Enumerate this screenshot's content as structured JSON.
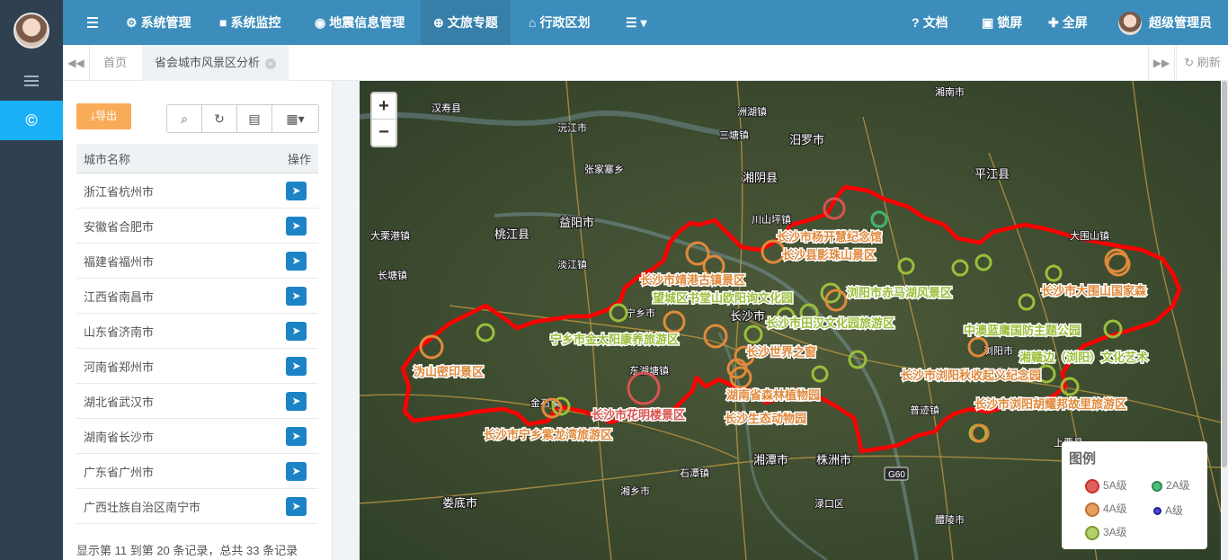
{
  "topbar": {
    "menu_items": [
      {
        "icon": "gear-icon",
        "label": "系统管理"
      },
      {
        "icon": "video-camera-icon",
        "label": "系统监控"
      },
      {
        "icon": "map-marker-icon",
        "label": "地震信息管理"
      },
      {
        "icon": "globe-icon",
        "label": "文旅专题"
      },
      {
        "icon": "bank-icon",
        "label": "行政区划"
      }
    ],
    "right_items": [
      {
        "icon": "question-circle-icon",
        "label": "文档"
      },
      {
        "icon": "lock-icon",
        "label": "锁屏"
      },
      {
        "icon": "expand-icon",
        "label": "全屏"
      }
    ],
    "username": "超级管理员"
  },
  "tabs": {
    "home": "首页",
    "active": "省会城市风景区分析",
    "refresh": "刷新"
  },
  "panel": {
    "export_label": "导出",
    "column_city": "城市名称",
    "column_action": "操作",
    "rows": [
      "浙江省杭州市",
      "安徽省合肥市",
      "福建省福州市",
      "江西省南昌市",
      "山东省济南市",
      "河南省郑州市",
      "湖北省武汉市",
      "湖南省长沙市",
      "广东省广州市",
      "广西壮族自治区南宁市"
    ],
    "footer": "显示第 11 到第 20 条记录，总共 33 条记录"
  },
  "map": {
    "zoom_in": "+",
    "zoom_out": "−",
    "places": [
      "汉寿县",
      "沅江市",
      "三塘镇",
      "汨罗市",
      "湘阴县",
      "平江县",
      "益阳市",
      "桃江县",
      "宁乡市",
      "长沙市",
      "浏阳市",
      "湘潭市",
      "株洲市",
      "娄底市",
      "湘乡市",
      "醴陵市",
      "张家塞乡",
      "大栗港镇",
      "长塘镇",
      "淡江镇",
      "川山坪镇",
      "洲湖镇",
      "大围山镇",
      "普迹镇",
      "上栗县",
      "东湖塘镇",
      "金石镇",
      "湘南市",
      "石潭镇",
      "渌口区"
    ],
    "spots": [
      {
        "label": "长沙市杨开慧纪念馆",
        "color": "#d9534f"
      },
      {
        "label": "长沙县影珠山景区",
        "color": "#e08a3c"
      },
      {
        "label": "长沙市靖港古镇景区",
        "color": "#e08a3c"
      },
      {
        "label": "望城区书堂山欧阳询文化园",
        "color": "#9bbf3b"
      },
      {
        "label": "浏阳市赤马湖风景区",
        "color": "#9bbf3b"
      },
      {
        "label": "长沙市大围山国家森",
        "color": "#e08a3c"
      },
      {
        "label": "长沙市田汉文化园旅游区",
        "color": "#9bbf3b"
      },
      {
        "label": "宁乡市金太阳康养旅游区",
        "color": "#9bbf3b"
      },
      {
        "label": "长沙世界之窗",
        "color": "#e08a3c"
      },
      {
        "label": "中澳蓝鹰国防主题公园",
        "color": "#9bbf3b"
      },
      {
        "label": "湘赣边（浏阳）文化艺术",
        "color": "#9bbf3b"
      },
      {
        "label": "沩山密印景区",
        "color": "#e08a3c"
      },
      {
        "label": "长沙市浏阳秋收起义纪念园",
        "color": "#e08a3c"
      },
      {
        "label": "湖南省森林植物园",
        "color": "#e08a3c"
      },
      {
        "label": "长沙市浏阳胡耀邦故里旅游区",
        "color": "#e08a3c"
      },
      {
        "label": "长沙市花明楼景区",
        "color": "#d9534f"
      },
      {
        "label": "长沙生态动物园",
        "color": "#e08a3c"
      },
      {
        "label": "长沙市宁乡紫龙湾旅游区",
        "color": "#e08a3c"
      }
    ],
    "road_badge": "G60"
  },
  "legend": {
    "title": "图例",
    "items": [
      {
        "label": "5A级",
        "color": "#d9534f"
      },
      {
        "label": "2A级",
        "color": "#3cb371"
      },
      {
        "label": "4A级",
        "color": "#e08a3c"
      },
      {
        "label": "A级",
        "color": "#3d3dd8"
      },
      {
        "label": "3A级",
        "color": "#9bbf3b"
      }
    ]
  },
  "colors": {
    "sidebar": "#2f4050",
    "topbar": "#3c8dbc",
    "accent": "#1ab0f5",
    "export": "#f8ac59",
    "action": "#1c84c6",
    "boundary": "#ff0000"
  }
}
